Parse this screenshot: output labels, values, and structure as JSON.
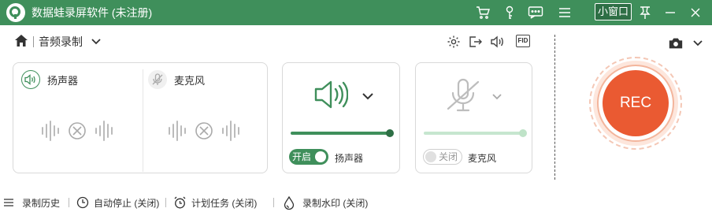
{
  "window": {
    "title": "数据蛙录屏软件 (未注册)",
    "mini_window_label": "小窗口",
    "icons": [
      "cart-icon",
      "key-icon",
      "chat-icon",
      "menu-icon",
      "pin-icon",
      "minimize-icon",
      "close-icon"
    ]
  },
  "colors": {
    "brand_green": "#3f8f5b",
    "rec_orange": "#ea5a32"
  },
  "mode": {
    "label": "音频录制"
  },
  "audio_sources": {
    "speaker_label": "扬声器",
    "mic_label": "麦克风"
  },
  "speaker_panel": {
    "toggle_label": "开启",
    "source_label": "扬声器",
    "enabled": true,
    "volume": 1.0
  },
  "mic_panel": {
    "toggle_label": "关闭",
    "source_label": "麦克风",
    "enabled": false,
    "volume": 1.0
  },
  "rec": {
    "label": "REC"
  },
  "bottom": {
    "history": "录制历史",
    "auto_stop": "自动停止 (关闭)",
    "schedule": "计划任务 (关闭)",
    "watermark": "录制水印 (关闭)"
  }
}
